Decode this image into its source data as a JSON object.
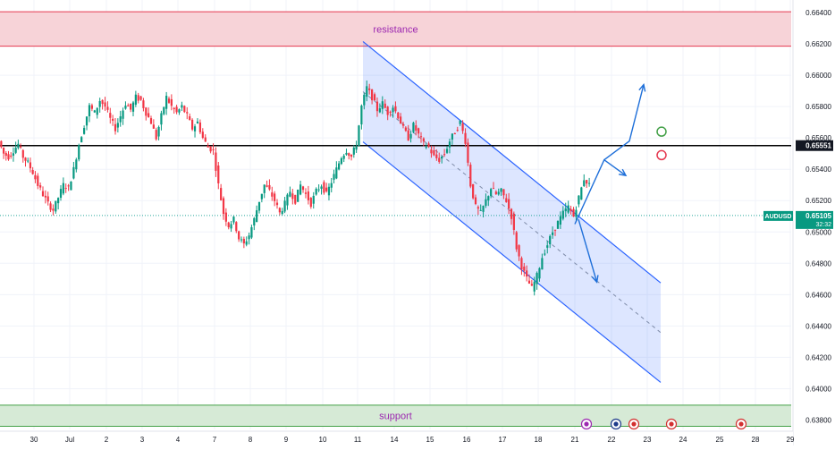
{
  "chart_data": {
    "type": "candlestick",
    "symbol": "AUDUSD",
    "y_tick_labels": [
      "0.66400",
      "0.66200",
      "0.66000",
      "0.65800",
      "0.65600",
      "0.65400",
      "0.65200",
      "0.65000",
      "0.64800",
      "0.64600",
      "0.64400",
      "0.64200",
      "0.64000",
      "0.63800"
    ],
    "y_ticks": [
      0.664,
      0.662,
      0.66,
      0.658,
      0.656,
      0.654,
      0.652,
      0.65,
      0.648,
      0.646,
      0.644,
      0.642,
      0.64,
      0.638
    ],
    "ylim": [
      0.6374,
      0.6648
    ],
    "x_tick_labels": [
      "30",
      "Jul",
      "2",
      "3",
      "4",
      "7",
      "8",
      "9",
      "10",
      "11",
      "14",
      "15",
      "16",
      "17",
      "18",
      "21",
      "22",
      "23",
      "24",
      "25",
      "28",
      "29"
    ],
    "current_price_label": "0.65105",
    "countdown_label": "32:32",
    "current_price": 0.65105,
    "horizontal_level_label": "0.65551",
    "horizontal_level": 0.65551,
    "zones": [
      {
        "label": "resistance",
        "from": 0.66185,
        "to": 0.66405,
        "color": "#f7d3d8",
        "edge": "#e53950"
      },
      {
        "label": "support",
        "from": 0.6376,
        "to": 0.63895,
        "color": "#d6ead6",
        "edge": "#43a047"
      }
    ],
    "channel": {
      "start_date": "11",
      "upper": [
        0.66215,
        0.64675
      ],
      "lower": [
        0.65575,
        0.6404
      ],
      "mid": [
        0.65895,
        0.64358
      ],
      "end_date": "after 23"
    },
    "series": [
      {
        "date": "27",
        "values": [
          0.6558,
          0.655,
          0.6548,
          0.6552,
          0.6556,
          0.6548,
          0.6544,
          0.6538
        ]
      },
      {
        "date": "30",
        "values": [
          0.6538,
          0.653,
          0.6524,
          0.6518,
          0.6514,
          0.6522,
          0.653,
          0.6528
        ]
      },
      {
        "date": "Jul",
        "values": [
          0.6528,
          0.654,
          0.6556,
          0.6568,
          0.658,
          0.6576,
          0.6584,
          0.658
        ]
      },
      {
        "date": "2",
        "values": [
          0.658,
          0.6572,
          0.6566,
          0.6574,
          0.6582,
          0.6578,
          0.6586,
          0.6584
        ]
      },
      {
        "date": "3",
        "values": [
          0.6584,
          0.6576,
          0.657,
          0.656,
          0.6574,
          0.6586,
          0.658,
          0.6576
        ]
      },
      {
        "date": "4",
        "values": [
          0.6576,
          0.658,
          0.6574,
          0.6566,
          0.657,
          0.656,
          0.6554,
          0.6552
        ]
      },
      {
        "date": "7",
        "values": [
          0.6552,
          0.653,
          0.6512,
          0.6504,
          0.6508,
          0.6496,
          0.6492,
          0.6498
        ]
      },
      {
        "date": "8",
        "values": [
          0.6498,
          0.6508,
          0.652,
          0.653,
          0.6526,
          0.652,
          0.6512,
          0.6518
        ]
      },
      {
        "date": "9",
        "values": [
          0.6518,
          0.6526,
          0.652,
          0.653,
          0.6524,
          0.6518,
          0.6526,
          0.653
        ]
      },
      {
        "date": "10",
        "values": [
          0.653,
          0.6524,
          0.6532,
          0.654,
          0.6548,
          0.6552,
          0.6548,
          0.6556
        ]
      },
      {
        "date": "11",
        "values": [
          0.6556,
          0.658,
          0.6592,
          0.6586,
          0.6578,
          0.6582,
          0.6576,
          0.658
        ]
      },
      {
        "date": "14",
        "values": [
          0.658,
          0.6574,
          0.6566,
          0.656,
          0.6568,
          0.6562,
          0.6556,
          0.6554
        ]
      },
      {
        "date": "15",
        "values": [
          0.6554,
          0.6548,
          0.6546,
          0.655,
          0.6558,
          0.6564,
          0.657,
          0.6558
        ]
      },
      {
        "date": "16",
        "values": [
          0.6558,
          0.653,
          0.6516,
          0.6512,
          0.652,
          0.6528,
          0.6524,
          0.6526
        ]
      },
      {
        "date": "17",
        "values": [
          0.6526,
          0.652,
          0.651,
          0.649,
          0.6478,
          0.647,
          0.6464,
          0.6472
        ]
      },
      {
        "date": "18",
        "values": [
          0.6472,
          0.6484,
          0.6492,
          0.65,
          0.6506,
          0.6512,
          0.6516,
          0.651
        ]
      },
      {
        "date": "21",
        "values": [
          0.651,
          0.6522,
          0.6534,
          0.653,
          0.6518,
          0.6512,
          0.6508,
          0.651
        ]
      }
    ],
    "annotations": [
      {
        "type": "arrow-path",
        "points": [
          [
            "21",
            0.6505
          ],
          [
            "21.8",
            0.6546
          ],
          [
            "22.4",
            0.6536
          ]
        ],
        "color": "#1e6fd9"
      },
      {
        "type": "arrow-path",
        "points": [
          [
            "21.8",
            0.6546
          ],
          [
            "22.5",
            0.6558
          ],
          [
            "22.9",
            0.6594
          ]
        ],
        "color": "#1e6fd9"
      },
      {
        "type": "arrow-path",
        "points": [
          [
            "21.1",
            0.6508
          ],
          [
            "21.6",
            0.6468
          ]
        ],
        "color": "#1e6fd9"
      },
      {
        "type": "marker",
        "color": "#43a047"
      },
      {
        "type": "marker",
        "color": "#e53950"
      }
    ],
    "grid": true
  }
}
